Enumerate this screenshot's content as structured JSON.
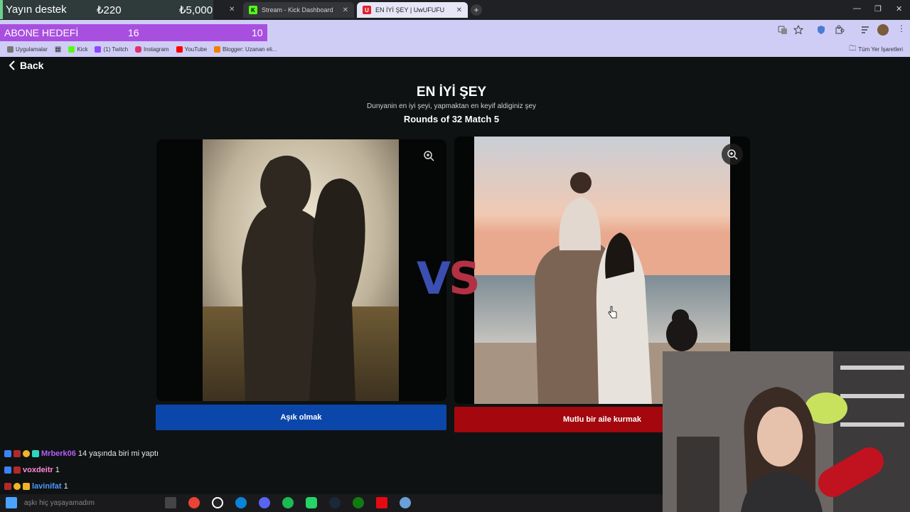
{
  "overlay": {
    "donation_label": "Yayın destek",
    "donation_current": "₺220",
    "donation_goal": "₺5,000",
    "sub_goal_label": "ABONE HEDEFİ",
    "sub_goal_current": "16",
    "sub_goal_target": "10"
  },
  "browser": {
    "tabs": [
      {
        "title": "Stream - Kick Dashboard",
        "icon": "kick-icon"
      },
      {
        "title": "EN İYİ ŞEY | UwUFUFU",
        "icon": "uwufufu-icon",
        "active": true
      }
    ],
    "bookmarks": [
      "Uygulamalar",
      "Kick",
      "(1) Twitch",
      "Instagram",
      "YouTube",
      "Blogger: Uzanan eli..."
    ],
    "all_bookmarks": "Tüm Yer İşaretleri"
  },
  "page": {
    "back_label": "Back",
    "title": "EN İYİ ŞEY",
    "subtitle": "Dunyanin en iyi şeyi, yapmaktan en keyif aldiginiz şey",
    "rounds": "Rounds of 32 Match 5",
    "vs_label": "VS",
    "left_choice": "Aşık olmak",
    "right_choice": "Mutlu bir aile kurmak"
  },
  "chat": [
    {
      "user": "Mrberk06",
      "message": "14 yaşında biri mi yaptı",
      "color": "#b45cff"
    },
    {
      "user": "voxdeitr",
      "message": "1",
      "color": "#ff8ad8"
    },
    {
      "user": "lavinifat",
      "message": "1",
      "color": "#4a9bff"
    }
  ],
  "taskbar": {
    "overlay_text": "aşkı hiç yaşayamadım"
  },
  "colors": {
    "left_button": "#0b47aa",
    "right_button": "#a4070d",
    "vs_blue": "#3a4fb0",
    "vs_red": "#b23142"
  }
}
